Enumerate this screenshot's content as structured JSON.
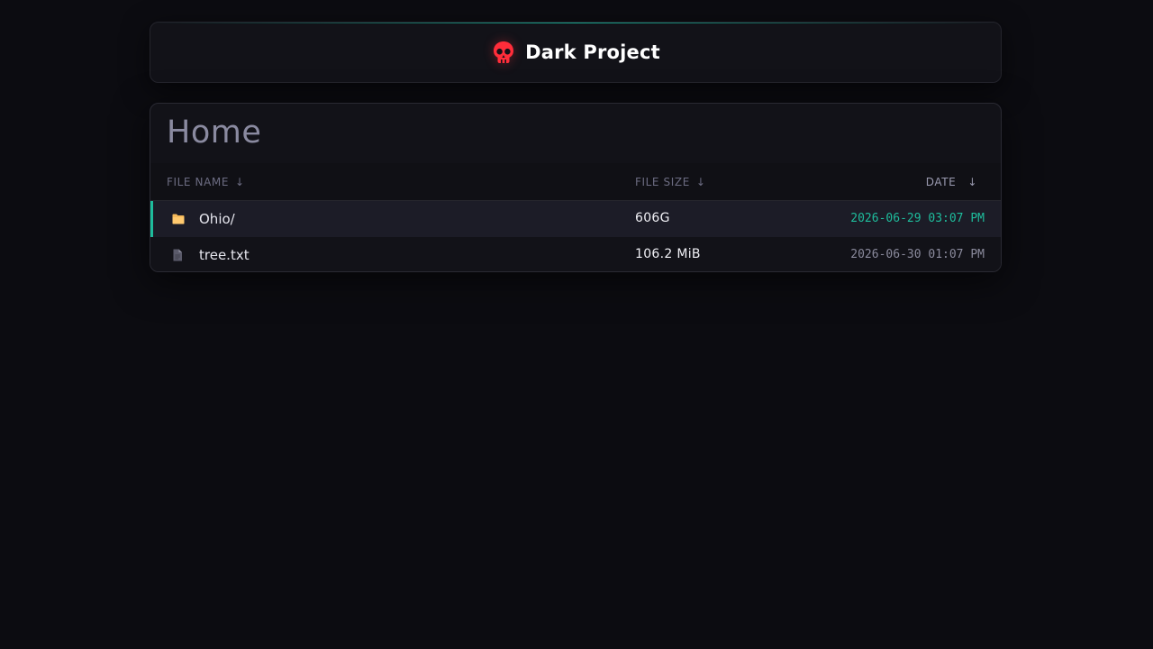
{
  "header": {
    "brand_icon": "skull-icon",
    "title": "Dark Project"
  },
  "listing": {
    "heading": "Home",
    "columns": {
      "name": "FILE NAME",
      "size": "FILE SIZE",
      "date": "DATE",
      "sort_arrow": "↓"
    },
    "rows": [
      {
        "icon": "folder-icon",
        "name": "Ohio/",
        "size": "606G",
        "date": "2026-06-29 03:07 PM",
        "selected": true
      },
      {
        "icon": "file-icon",
        "name": "tree.txt",
        "size": "106.2 MiB",
        "date": "2026-06-30 01:07 PM",
        "selected": false
      }
    ]
  },
  "colors": {
    "accent": "#1ebc9c",
    "skull": "#ff2d3a",
    "folder": "#f5b95a",
    "background": "#0c0c11"
  }
}
